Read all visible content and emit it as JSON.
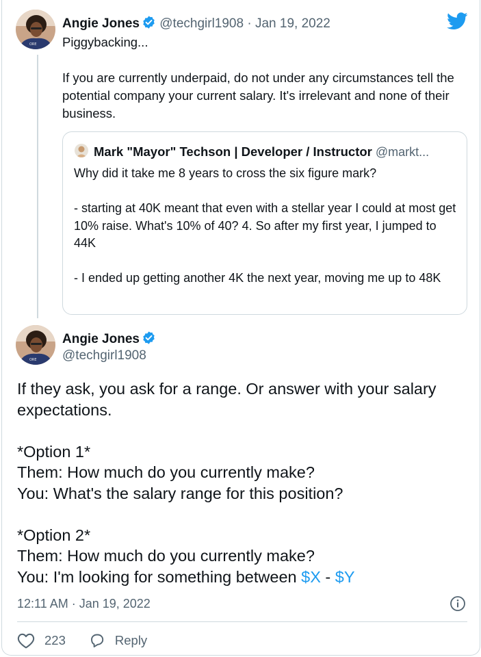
{
  "tweet": {
    "author_name": "Angie Jones",
    "handle": "@techgirl1908",
    "date": "Jan 19, 2022",
    "body": "Piggybacking...\n\nIf you are currently underpaid, do not under any circumstances tell the potential company your current salary. It's irrelevant and none of their business."
  },
  "quote": {
    "author_name": "Mark \"Mayor\" Techson | Developer / Instructor",
    "handle": "@markt...",
    "body": "Why did it take me 8 years to cross the six figure mark?\n\n- starting at 40K meant that even with a stellar year I could at most get 10% raise. What's 10% of 40? 4. So after my first year, I jumped to 44K\n\n- I ended up getting another 4K the next year, moving me up to 48K"
  },
  "reply": {
    "author_name": "Angie Jones",
    "handle": "@techgirl1908",
    "body_main": "If they ask, you ask for a range. Or answer with your salary expectations.\n\n*Option 1*\nThem: How much do you currently make?\nYou: What's the salary range for this position?\n\n*Option 2*\nThem: How much do you currently make?\nYou: I'm looking for something between ",
    "link_x": "$X",
    "separator": " - ",
    "link_y": "$Y",
    "timestamp": "12:11 AM · Jan 19, 2022",
    "like_count": "223",
    "reply_label": "Reply"
  },
  "icons": {
    "logo": "twitter-bird-icon",
    "verified": "verified-badge-icon",
    "info": "info-icon",
    "like": "heart-icon",
    "reply": "reply-bubble-icon"
  },
  "colors": {
    "accent": "#1d9bf0",
    "text": "#0f1419",
    "muted": "#536471",
    "border": "#cfd9de"
  }
}
